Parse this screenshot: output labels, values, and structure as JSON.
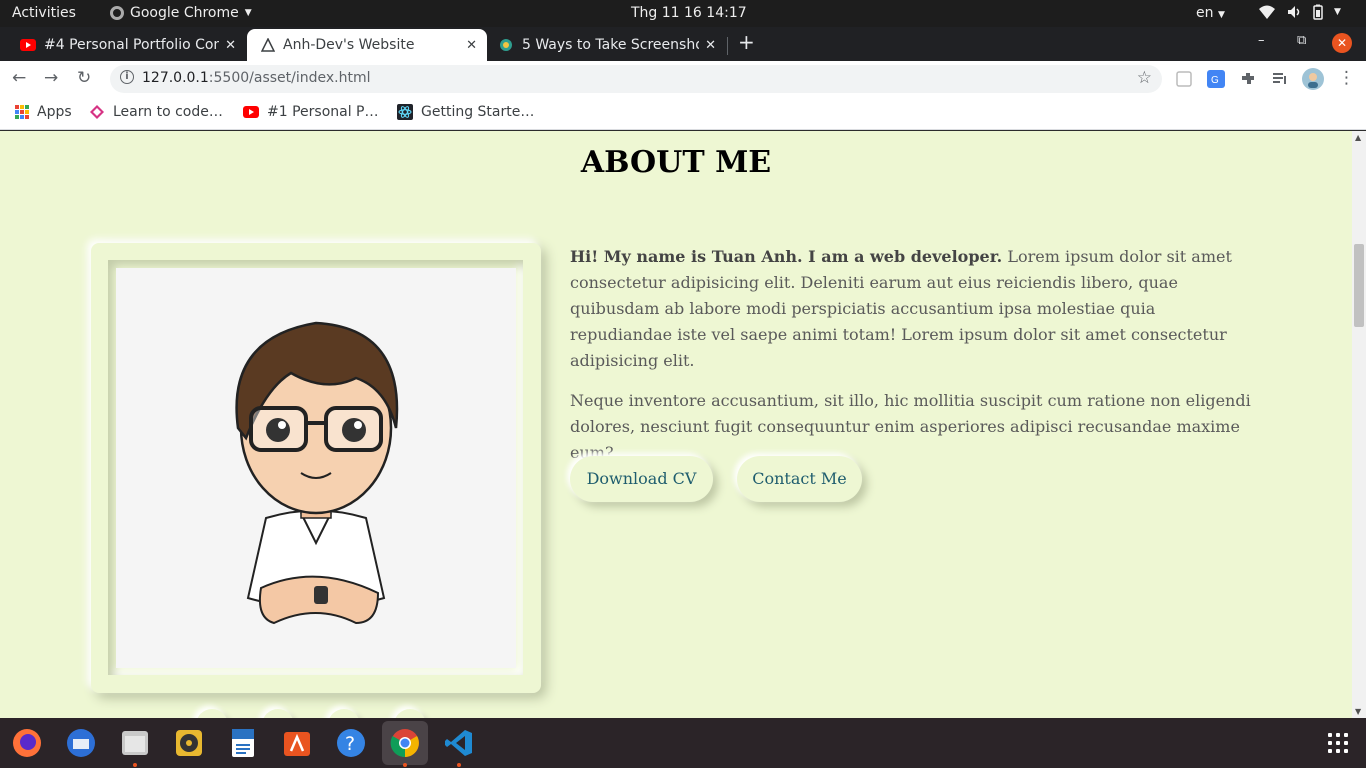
{
  "system": {
    "activities": "Activities",
    "app_menu": "Google Chrome",
    "clock": "Thg 11 16  14:17",
    "language": "en"
  },
  "browser": {
    "tabs": [
      {
        "title": "#4 Personal Portfolio Con",
        "icon": "youtube-icon",
        "active": false
      },
      {
        "title": "Anh-Dev's Website",
        "icon": "website-icon",
        "active": true
      },
      {
        "title": "5 Ways to Take Screensho",
        "icon": "gear-icon",
        "active": false
      }
    ],
    "url_host": "127.0.0.1",
    "url_path": ":5500/asset/index.html",
    "bookmarks": [
      {
        "label": "Apps",
        "icon": "apps-grid-icon"
      },
      {
        "label": "Learn to code…",
        "icon": "freecodecamp-icon"
      },
      {
        "label": "#1 Personal P…",
        "icon": "youtube-icon"
      },
      {
        "label": "Getting Starte…",
        "icon": "react-icon"
      }
    ]
  },
  "page": {
    "section_title": "ABOUT ME",
    "intro_bold": "Hi! My name is Tuan Anh. I am a web developer.",
    "intro_rest": " Lorem ipsum dolor sit amet consectetur adipisicing elit. Deleniti earum aut eius reiciendis libero, quae quibusdam ab labore modi perspiciatis accusantium ipsa molestiae quia repudiandae iste vel saepe animi totam! Lorem ipsum dolor sit amet consectetur adipisicing elit.",
    "paragraph_2": "Neque inventore accusantium, sit illo, hic mollitia suscipit cum ratione non eligendi dolores, nesciunt fugit consequuntur enim asperiores adipisci recusandae maxime eum?",
    "download_cv": "Download CV",
    "contact_me": "Contact Me",
    "colors": {
      "background": "#eef7d3",
      "button_text": "#1f5d6e"
    }
  },
  "dock": {
    "apps": [
      "firefox-icon",
      "thunderbird-icon",
      "files-icon",
      "rhythmbox-icon",
      "writer-icon",
      "software-icon",
      "help-icon",
      "chrome-icon",
      "vscode-icon"
    ]
  }
}
